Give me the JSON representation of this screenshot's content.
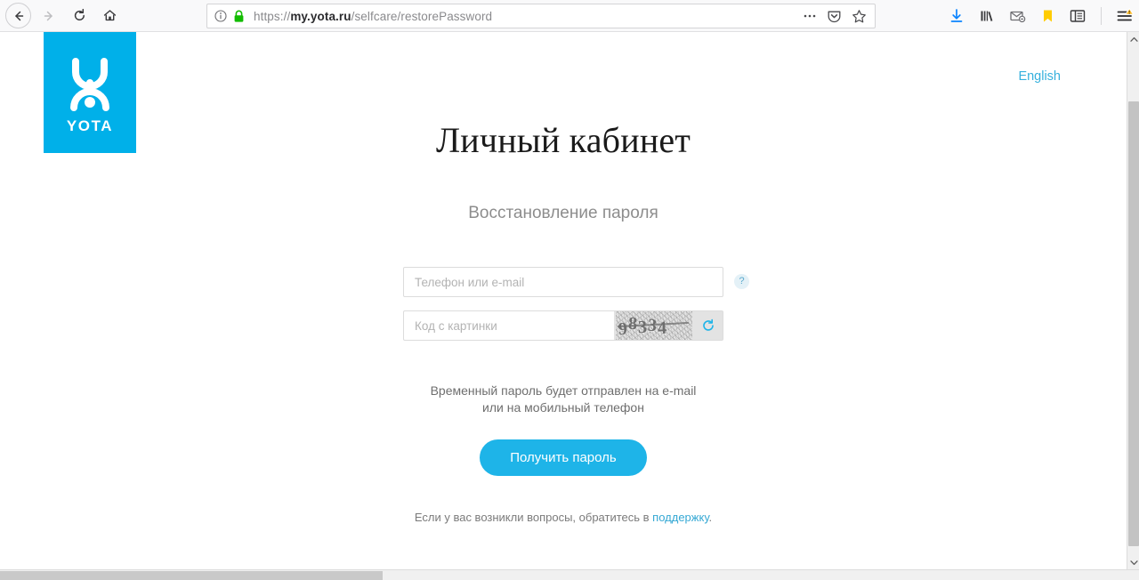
{
  "browser": {
    "nav": {
      "back_label": "Back",
      "forward_label": "Forward",
      "reload_label": "Reload",
      "home_label": "Home"
    },
    "urlbar": {
      "scheme": "https://",
      "host": "my.yota.ru",
      "path": "/selfcare/restorePassword",
      "full_url": "https://my.yota.ru/selfcare/restorePassword",
      "security": "secure-lock",
      "page_info_label": "Page info",
      "page_actions_label": "Page actions",
      "pocket_label": "Save to Pocket",
      "bookmark_label": "Bookmark this page"
    },
    "toolbar_right": {
      "downloads_label": "Downloads",
      "library_label": "Library",
      "email_label": "Email",
      "bookmarks_label": "Bookmarks",
      "sidebar_label": "Sidebar",
      "menu_label": "Open menu"
    }
  },
  "page": {
    "logo": {
      "wordmark": "YOTA",
      "bg_color": "#00b0e9"
    },
    "language_link": "English",
    "title": "Личный кабинет",
    "subtitle": "Восстановление пароля",
    "fields": {
      "login": {
        "placeholder": "Телефон или e-mail",
        "value": "",
        "help_glyph": "?"
      },
      "captcha": {
        "placeholder": "Код с картинки",
        "value": "",
        "image_code": "98334",
        "refresh_label": "Обновить"
      }
    },
    "hint_line1": "Временный пароль будет отправлен на e-mail",
    "hint_line2": "или на мобильный телефон",
    "submit_label": "Получить пароль",
    "support_prefix": "Если у вас возникли вопросы, обратитесь в ",
    "support_link": "поддержку",
    "support_suffix": ".",
    "accent_color": "#1eb4e8",
    "link_color": "#35a8d4"
  }
}
